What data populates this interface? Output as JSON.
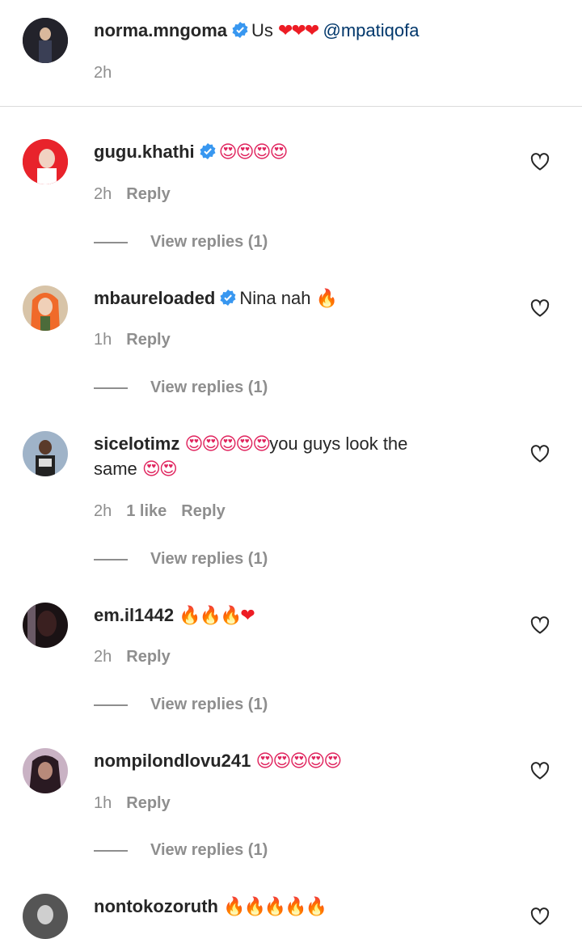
{
  "caption": {
    "username": "norma.mngoma",
    "text": "Us",
    "emojis": "❤❤❤",
    "mention": "@mpatiqofa",
    "time": "2h"
  },
  "comments": [
    {
      "username": "gugu.khathi",
      "verified": true,
      "text": "",
      "emojis": "😍😍😍😍",
      "text2": "",
      "time": "2h",
      "likes": "",
      "reply": "Reply",
      "view_replies": "View replies (1)",
      "avatar_color": "#e8232b"
    },
    {
      "username": "mbaureloaded",
      "verified": true,
      "text": "Nina nah",
      "emojis": "🔥",
      "text2": "",
      "time": "1h",
      "likes": "",
      "reply": "Reply",
      "view_replies": "View replies (1)",
      "avatar_color": "#f06a2a"
    },
    {
      "username": "sicelotimz",
      "verified": false,
      "text": "",
      "emojis": "😍😍😍😍😍",
      "text2": "you guys look the",
      "line2_text": "same",
      "line2_emojis": "😍😍",
      "time": "2h",
      "likes": "1 like",
      "reply": "Reply",
      "view_replies": "View replies (1)",
      "avatar_color": "#7a8fa6"
    },
    {
      "username": "em.il1442",
      "verified": false,
      "text": "",
      "emojis": "🔥🔥🔥",
      "emojis_red": "❤",
      "text2": "",
      "time": "2h",
      "likes": "",
      "reply": "Reply",
      "view_replies": "View replies (1)",
      "avatar_color": "#2a1a1a"
    },
    {
      "username": "nompilondlovu241",
      "verified": false,
      "text": "",
      "emojis": "😍😍😍😍😍",
      "text2": "",
      "time": "1h",
      "likes": "",
      "reply": "Reply",
      "view_replies": "View replies (1)",
      "avatar_color": "#9c7a8a"
    },
    {
      "username": "nontokozoruth",
      "verified": false,
      "text": "",
      "emojis": "🔥🔥🔥🔥🔥",
      "text2": "",
      "time": "",
      "likes": "",
      "reply": "",
      "view_replies": "",
      "avatar_color": "#444444"
    }
  ]
}
